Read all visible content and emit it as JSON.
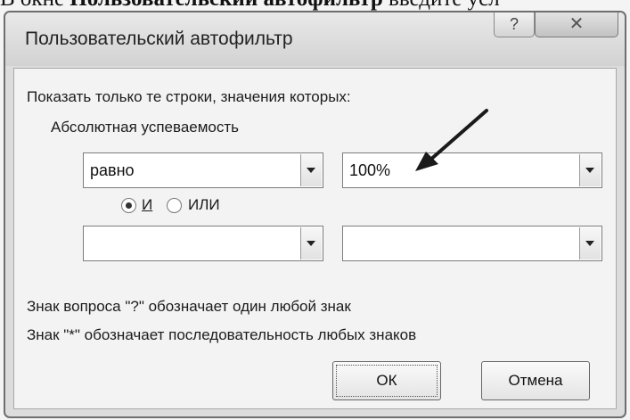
{
  "page_header": {
    "prefix": "В окне ",
    "bold": "Пользовательский автофильтр",
    "suffix": " введите усл"
  },
  "dialog": {
    "title": "Пользовательский автофильтр",
    "help_label": "?",
    "close_label": "✕",
    "instruction": "Показать только те строки, значения которых:",
    "field_name": "Абсолютная успеваемость",
    "row1": {
      "operator": "равно",
      "value": "100%"
    },
    "logic": {
      "and_label": "И",
      "or_label": "ИЛИ",
      "selected": "and"
    },
    "row2": {
      "operator": "",
      "value": ""
    },
    "hint1": "Знак вопроса \"?\" обозначает один любой знак",
    "hint2": "Знак \"*\" обозначает последовательность любых знаков",
    "ok_label": "ОК",
    "cancel_label": "Отмена"
  }
}
